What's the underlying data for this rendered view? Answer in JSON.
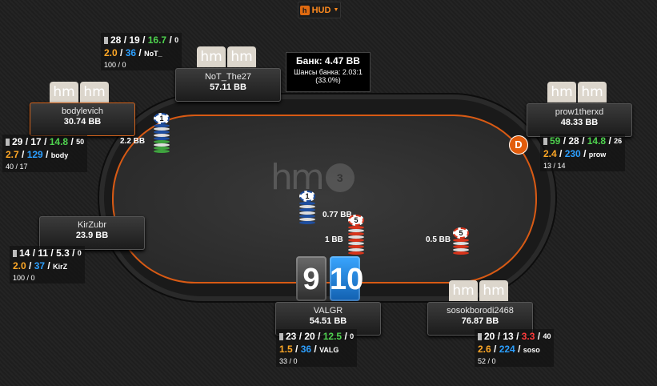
{
  "hud_button": {
    "label": "HUD",
    "logo": "h"
  },
  "felt_logo": {
    "text": "hm",
    "badge": "3"
  },
  "pot": {
    "label": "Банк: 4.47 BB",
    "odds": "Шансы банка: 2.03:1",
    "pct": "(33.0%)"
  },
  "hm_tag": "hm",
  "dealer_button": "D",
  "players": {
    "not": {
      "name": "NoT_The27",
      "stack": "57.11 BB",
      "s1": "28",
      "s2": "19",
      "s3": "16.7",
      "s4": "0",
      "a1": "2.0",
      "a2": "36",
      "short": "NoT_",
      "r3a": "100",
      "r3b": "0"
    },
    "body": {
      "name": "bodylevich",
      "stack": "30.74 BB",
      "s1": "29",
      "s2": "17",
      "s3": "14.8",
      "s4": "50",
      "a1": "2.7",
      "a2": "129",
      "short": "body",
      "r3a": "40",
      "r3b": "17"
    },
    "prow": {
      "name": "prow1therxd",
      "stack": "48.33 BB",
      "s1": "59",
      "s2": "28",
      "s3": "14.8",
      "s4": "26",
      "a1": "2.4",
      "a2": "230",
      "short": "prow",
      "r3a": "13",
      "r3b": "14"
    },
    "kir": {
      "name": "KirZubr",
      "stack": "23.9 BB",
      "s1": "14",
      "s2": "11",
      "s3": "5.3",
      "s4": "0",
      "a1": "2.0",
      "a2": "37",
      "short": "KirZ",
      "r3a": "100",
      "r3b": "0"
    },
    "valgr": {
      "name": "VALGR",
      "stack": "54.51 BB",
      "s1": "23",
      "s2": "20",
      "s3": "12.5",
      "s4": "0",
      "a1": "1.5",
      "a2": "36",
      "short": "VALG",
      "r3a": "33",
      "r3b": "0"
    },
    "soso": {
      "name": "sosokborodi2468",
      "stack": "76.87 BB",
      "s1": "20",
      "s2": "13",
      "s3": "3.3",
      "s4": "40",
      "a1": "2.6",
      "a2": "224",
      "short": "soso",
      "r3a": "52",
      "r3b": "0"
    }
  },
  "bets": {
    "body": {
      "amount": "2.2 BB",
      "chip": "1"
    },
    "kir": {
      "amount": "0.77 BB",
      "chip": "1"
    },
    "valgr": {
      "amount": "1 BB",
      "chip": "5"
    },
    "soso": {
      "amount": "0.5 BB",
      "chip": "5"
    }
  },
  "hero_cards": [
    {
      "rank": "9",
      "suit": "spade"
    },
    {
      "rank": "10",
      "suit": "diamond"
    }
  ],
  "colors": {
    "accent": "#d85a14",
    "green": "#4ed24e",
    "orange": "#ffa826",
    "blue": "#2c9fff",
    "red": "#ff3b3b"
  }
}
